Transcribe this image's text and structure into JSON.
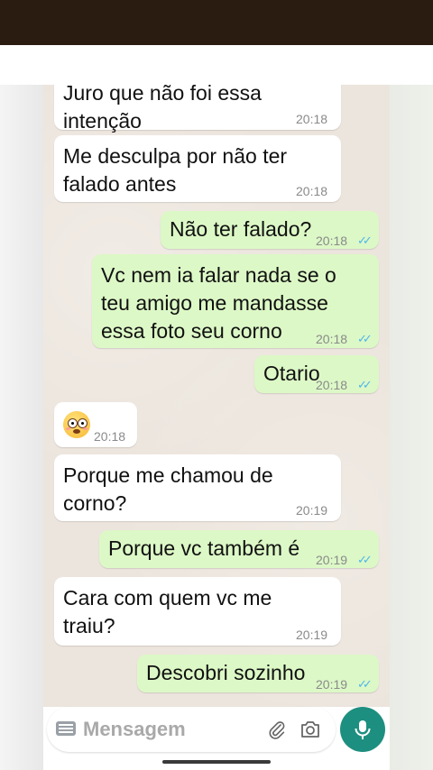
{
  "messages": [
    {
      "dir": "in",
      "text": "Juro que não foi essa\nintenção",
      "time": "20:18"
    },
    {
      "dir": "in",
      "text": "Me desculpa por não ter\nfalado antes",
      "time": "20:18"
    },
    {
      "dir": "out",
      "text": "Não ter falado?",
      "time": "20:18"
    },
    {
      "dir": "out",
      "text": "Vc nem ia falar nada se o\nteu amigo me mandasse\nessa foto seu corno",
      "time": "20:18"
    },
    {
      "dir": "out",
      "text": "Otario",
      "time": "20:18"
    },
    {
      "dir": "in",
      "emoji": "flushed-face",
      "time": "20:18"
    },
    {
      "dir": "in",
      "text": "Porque me chamou de\ncorno?",
      "time": "20:19"
    },
    {
      "dir": "out",
      "text": "Porque vc também é",
      "time": "20:19"
    },
    {
      "dir": "in",
      "text": "Cara com quem vc me\ntraiu?",
      "time": "20:19"
    },
    {
      "dir": "out",
      "text": "Descobri sozinho",
      "time": "20:19"
    }
  ],
  "input": {
    "placeholder": "Mensagem"
  },
  "icons": {
    "keyboard": "keyboard-icon",
    "attach": "paperclip-icon",
    "camera": "camera-icon",
    "mic": "microphone-icon",
    "read_receipt": "double-check-icon"
  },
  "colors": {
    "incoming": "#ffffff",
    "outgoing": "#dcf8c6",
    "chat_bg": "#ece5dd",
    "mic_button": "#1d8f80",
    "ticks": "#4fb6ec"
  }
}
